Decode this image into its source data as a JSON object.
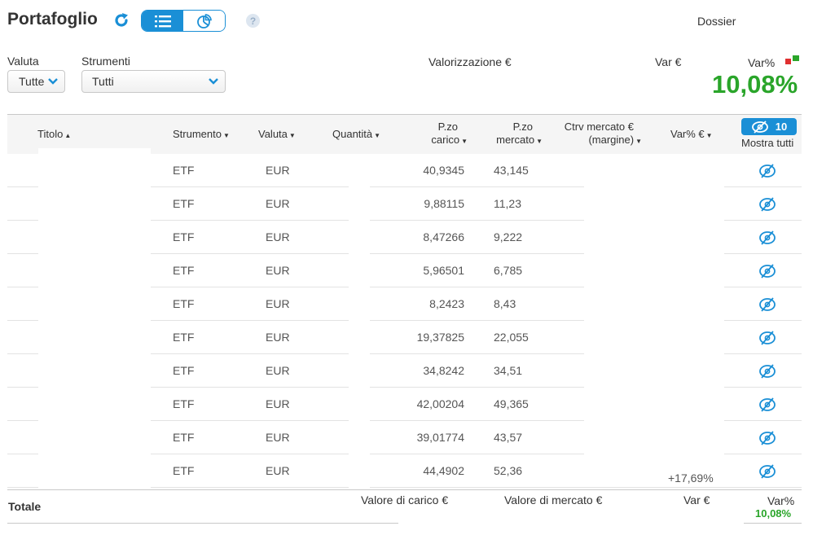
{
  "header": {
    "title": "Portafoglio",
    "dossier_label": "Dossier",
    "help_label": "?"
  },
  "filters": {
    "valuta_label": "Valuta",
    "valuta_value": "Tutte",
    "strumenti_label": "Strumenti",
    "strumenti_value": "Tutti"
  },
  "summary": {
    "valorizzazione_label": "Valorizzazione €",
    "var_label": "Var €",
    "var_pct_label": "Var%",
    "var_pct_value": "10,08%"
  },
  "table": {
    "columns": {
      "titolo": "Titolo",
      "strumento": "Strumento",
      "valuta": "Valuta",
      "quantita": "Quantità",
      "pzo_carico_1": "P.zo",
      "pzo_carico_2": "carico",
      "pzo_mercato_1": "P.zo",
      "pzo_mercato_2": "mercato",
      "ctrv_1": "Ctrv mercato €",
      "ctrv_2": "(margine)",
      "var_pct_eur": "Var% €",
      "hidden_count": "10",
      "mostra_tutti": "Mostra tutti"
    },
    "rows": [
      {
        "strumento": "ETF",
        "valuta": "EUR",
        "pzo_carico": "40,9345",
        "pzo_mercato": "43,145"
      },
      {
        "strumento": "ETF",
        "valuta": "EUR",
        "pzo_carico": "9,88115",
        "pzo_mercato": "11,23"
      },
      {
        "strumento": "ETF",
        "valuta": "EUR",
        "pzo_carico": "8,47266",
        "pzo_mercato": "9,222"
      },
      {
        "strumento": "ETF",
        "valuta": "EUR",
        "pzo_carico": "5,96501",
        "pzo_mercato": "6,785"
      },
      {
        "strumento": "ETF",
        "valuta": "EUR",
        "pzo_carico": "8,2423",
        "pzo_mercato": "8,43"
      },
      {
        "strumento": "ETF",
        "valuta": "EUR",
        "pzo_carico": "19,37825",
        "pzo_mercato": "22,055"
      },
      {
        "strumento": "ETF",
        "valuta": "EUR",
        "pzo_carico": "34,8242",
        "pzo_mercato": "34,51"
      },
      {
        "strumento": "ETF",
        "valuta": "EUR",
        "pzo_carico": "42,00204",
        "pzo_mercato": "49,365"
      },
      {
        "strumento": "ETF",
        "valuta": "EUR",
        "pzo_carico": "39,01774",
        "pzo_mercato": "43,57"
      },
      {
        "strumento": "ETF",
        "valuta": "EUR",
        "pzo_carico": "44,4902",
        "pzo_mercato": "52,36",
        "var_pct": "+17,69%"
      }
    ]
  },
  "totals": {
    "label": "Totale",
    "valore_carico_label": "Valore di carico €",
    "valore_mercato_label": "Valore di mercato €",
    "var_label": "Var €",
    "var_pct_label": "Var%",
    "var_pct_value": "10,08%"
  },
  "colors": {
    "accent": "#1a8fd6",
    "positive": "#2aa52a",
    "negative": "#e03030"
  }
}
